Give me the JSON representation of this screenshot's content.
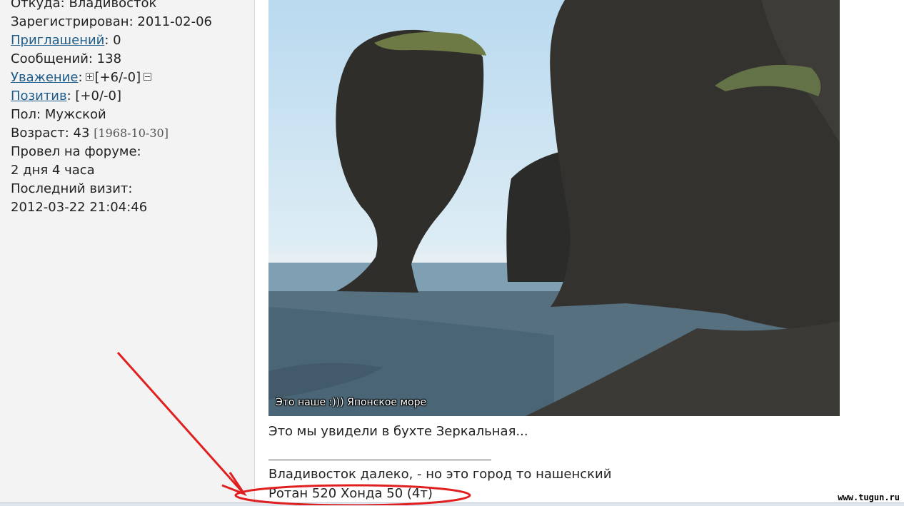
{
  "profile": {
    "from": "Откуда: Владивосток",
    "registered": "Зарегистрирован: 2011-02-06",
    "invites_link": "Приглашений",
    "invites_value": ": 0",
    "messages": "Сообщений: 138",
    "respect_link": "Уважение",
    "respect_value": "[+6/-0]",
    "positive_link": "Позитив",
    "positive_value": ": [+0/-0]",
    "gender": "Пол: Мужской",
    "age": "Возраст: 43",
    "birth_date": "[1968-10-30]",
    "forum_time_label": "Провел на форуме:",
    "forum_time_value": "2 дня 4 часа",
    "last_visit_label": "Последний визит:",
    "last_visit_value": "2012-03-22 21:04:46"
  },
  "post": {
    "photo_caption": "Это наше  :))) Японское море",
    "text": "Это мы увидели в бухте Зеркальная...",
    "signature_line1": "Владивосток далеко, - но это город то нашенский",
    "signature_line2": "Ротан 520 Хонда 50 (4т)"
  },
  "watermark": "www.tugun.ru",
  "colors": {
    "link": "#1d5c8a",
    "sidebar_bg": "#f3f3f3",
    "annotation": "#e02020"
  }
}
